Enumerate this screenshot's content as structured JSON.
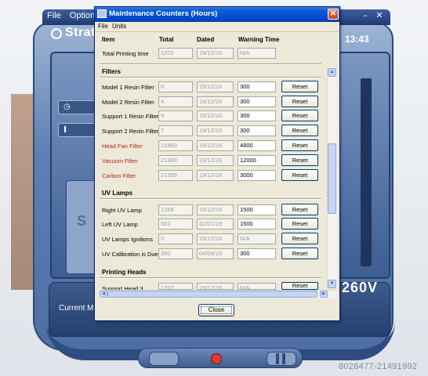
{
  "background_app": {
    "menu": [
      "File",
      "Option"
    ],
    "logo": "Strata",
    "time": "13:43",
    "current_mode_label": "Current Mod",
    "model": "260V",
    "watermark": "8028477-21491992",
    "side_letter": "S",
    "side_button_2": "I"
  },
  "dialog": {
    "title": "Maintenance Counters (Hours)",
    "close_glyph": "✕",
    "menu": [
      "File",
      "Units"
    ],
    "headers": {
      "item": "Item",
      "total": "Total",
      "dated": "Dated",
      "warning": "Warning Time"
    },
    "total_printing": {
      "label": "Total Printing time",
      "total": "1202",
      "dated": "19/12/16",
      "warning": "N/A"
    },
    "sections": [
      {
        "title": "Filters",
        "rows": [
          {
            "label": "Model 1 Resin Filter",
            "total": "6",
            "dated": "19/12/16",
            "warning": "300",
            "reset": "Reset",
            "red": false
          },
          {
            "label": "Model 2 Resin Filter",
            "total": "4",
            "dated": "19/12/16",
            "warning": "300",
            "reset": "Reset",
            "red": false
          },
          {
            "label": "Support 1 Resin Filter",
            "total": "9",
            "dated": "19/12/16",
            "warning": "300",
            "reset": "Reset",
            "red": false
          },
          {
            "label": "Support 2 Resin  Filter",
            "total": "7",
            "dated": "19/12/16",
            "warning": "300",
            "reset": "Reset",
            "red": false
          },
          {
            "label": "Head Fan Filter",
            "total": "21860",
            "dated": "19/12/16",
            "warning": "4800",
            "reset": "Reset",
            "red": true
          },
          {
            "label": "Vacuum Filter",
            "total": "21860",
            "dated": "19/12/16",
            "warning": "12000",
            "reset": "Reset",
            "red": true
          },
          {
            "label": "Carbon Filter",
            "total": "21555",
            "dated": "19/12/16",
            "warning": "3000",
            "reset": "Reset",
            "red": true
          }
        ]
      },
      {
        "title": "UV Lamps",
        "rows": [
          {
            "label": "Right UV Lamp",
            "total": "1358",
            "dated": "19/12/16",
            "warning": "1500",
            "reset": "Reset",
            "red": false
          },
          {
            "label": "Left UV Lamp",
            "total": "502",
            "dated": "22/01/19",
            "warning": "1500",
            "reset": "Reset",
            "red": false
          },
          {
            "label": "UV Lamps Ignitions",
            "total": "0",
            "dated": "19/12/16",
            "warning": "N/A",
            "reset": "Reset",
            "red": false,
            "warning_na": true
          },
          {
            "label": "UV Calibration is Due",
            "total": "200",
            "dated": "04/06/19",
            "warning": "300",
            "reset": "Reset",
            "red": false
          }
        ]
      },
      {
        "title": "Printing Heads",
        "rows": [
          {
            "label": "Support Head 3",
            "total": "1202",
            "dated": "19/12/16",
            "warning": "N/A",
            "reset": "Reset",
            "red": false,
            "warning_na": true
          }
        ]
      }
    ],
    "close_button": "Close"
  }
}
